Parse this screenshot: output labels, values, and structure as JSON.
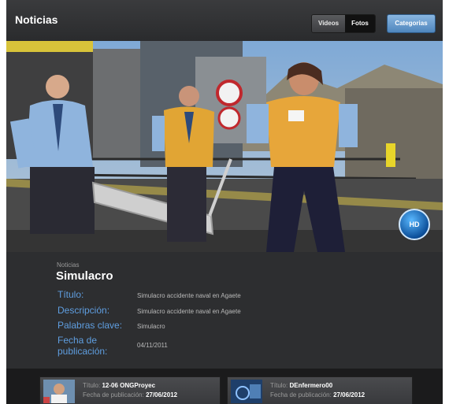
{
  "header": {
    "title": "Noticias",
    "tabs": [
      {
        "label": "Videos",
        "active": false
      },
      {
        "label": "Fotos",
        "active": true
      }
    ],
    "categories_label": "Categorias"
  },
  "video": {
    "badge": "HD"
  },
  "article": {
    "category": "Noticias",
    "headline": "Simulacro",
    "fields": [
      {
        "label": "Título:",
        "value": "Simulacro accidente naval en Agaete"
      },
      {
        "label": "Descripción:",
        "value": "Simulacro accidente naval en Agaete"
      },
      {
        "label": "Palabras clave:",
        "value": "Simulacro"
      },
      {
        "label": "Fecha de publicación:",
        "value": "04/11/2011"
      }
    ]
  },
  "related": [
    {
      "title_label": "Título:",
      "title": "12-06 ONGProyec",
      "date_label": "Fecha de publicación:",
      "date": "27/06/2012"
    },
    {
      "title_label": "Título:",
      "title": "DEnfermero00",
      "date_label": "Fecha de publicación:",
      "date": "27/06/2012"
    }
  ],
  "colors": {
    "background": "#2b2c2e",
    "accent_blue": "#5f9ee0",
    "button_blue": "#6a9fd2"
  }
}
